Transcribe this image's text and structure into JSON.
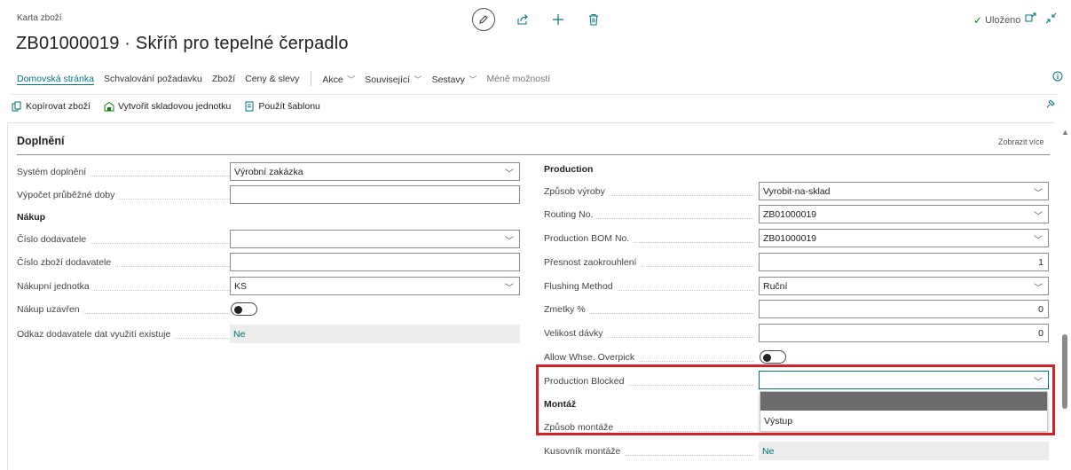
{
  "header": {
    "breadcrumb": "Karta zboží",
    "title": "ZB01000019 · Skříň pro tepelné čerpadlo",
    "status": "Uloženo"
  },
  "tabs": {
    "home": "Domovská stránka",
    "approval": "Schvalování požadavku",
    "item": "Zboží",
    "prices": "Ceny & slevy",
    "actions": "Akce",
    "related": "Související",
    "reports": "Sestavy",
    "fewer": "Méně možností"
  },
  "toolbar": {
    "copy": "Kopírovat zboží",
    "create_sku": "Vytvořit skladovou jednotku",
    "template": "Použít šablonu"
  },
  "section": {
    "title": "Doplnění",
    "show_more": "Zobrazit více"
  },
  "left": {
    "replenishment_label": "Systém doplnění",
    "replenishment_value": "Výrobní zakázka",
    "lead_time_label": "Výpočet průběžné doby",
    "lead_time_value": "",
    "purchase_heading": "Nákup",
    "vendor_no_label": "Číslo dodavatele",
    "vendor_no_value": "",
    "vendor_item_label": "Číslo zboží dodavatele",
    "vendor_item_value": "",
    "purch_unit_label": "Nákupní jednotka",
    "purch_unit_value": "KS",
    "purch_blocked_label": "Nákup uzavřen",
    "vendor_data_label": "Odkaz dodavatele dat využití existuje",
    "vendor_data_value": "Ne"
  },
  "right": {
    "production_heading": "Production",
    "mfg_policy_label": "Způsob výroby",
    "mfg_policy_value": "Vyrobit-na-sklad",
    "routing_label": "Routing No.",
    "routing_value": "ZB01000019",
    "bom_label": "Production BOM No.",
    "bom_value": "ZB01000019",
    "rounding_label": "Přesnost zaokrouhlení",
    "rounding_value": "1",
    "flushing_label": "Flushing Method",
    "flushing_value": "Ruční",
    "scrap_label": "Zmetky %",
    "scrap_value": "0",
    "lot_size_label": "Velikost dávky",
    "lot_size_value": "0",
    "overpick_label": "Allow Whse. Overpick",
    "prod_blocked_label": "Production Blocked",
    "prod_blocked_value": "",
    "assembly_heading": "Montáž",
    "assembly_policy_label": "Způsob montáže",
    "assembly_bom_label": "Kusovník montáže",
    "assembly_bom_value": "Ne"
  },
  "dropdown": {
    "option": "Výstup"
  },
  "colors": {
    "accent": "#00737a",
    "highlight_box": "#d2232a"
  }
}
